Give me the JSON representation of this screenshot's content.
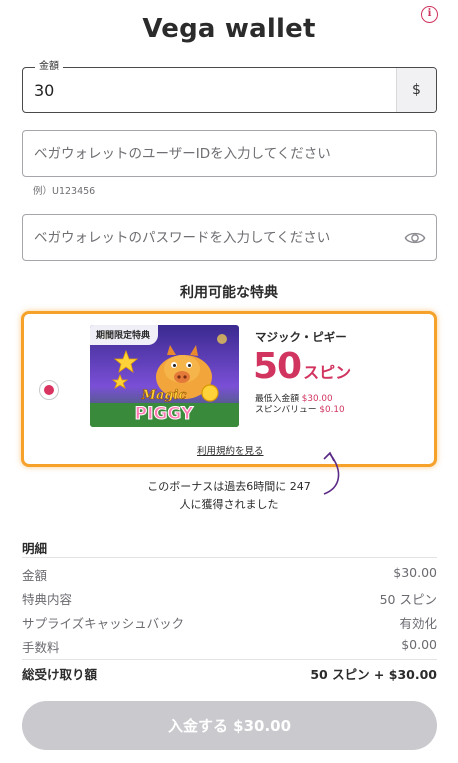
{
  "header": {
    "title": "Vega wallet",
    "info_icon": "i"
  },
  "amount": {
    "label": "金額",
    "value": "30",
    "currency": "$"
  },
  "user_id": {
    "placeholder": "ベガウォレットのユーザーIDを入力してください",
    "helper": "例）U123456"
  },
  "password": {
    "placeholder": "ベガウォレットのパスワードを入力してください"
  },
  "bonus_section": {
    "title": "利用可能な特典",
    "offer": {
      "badge": "期間限定特典",
      "game_logo_line1": "Magic",
      "game_logo_line2": "PIGGY",
      "name": "マジック・ピギー",
      "amount_number": "50",
      "amount_unit": "スピン",
      "min_deposit_label": "最低入金額",
      "min_deposit_value": "$30.00",
      "spin_value_label": "スピンバリュー",
      "spin_value_value": "$0.10",
      "terms_link": "利用規約を見る",
      "selected": true
    },
    "social_proof_line1": "このボーナスは過去6時間に 247",
    "social_proof_line2": "人に獲得されました"
  },
  "breakdown": {
    "title": "明細",
    "rows": [
      {
        "label": "金額",
        "value": "$30.00"
      },
      {
        "label": "特典内容",
        "value": "50 スピン"
      },
      {
        "label": "サプライズキャッシュバック",
        "value": "有効化"
      },
      {
        "label": "手数料",
        "value": "$0.00"
      }
    ],
    "total": {
      "label": "総受け取り額",
      "value": "50 スピン + $30.00"
    }
  },
  "deposit_button": {
    "label": "入金する $30.00",
    "enabled": false
  },
  "colors": {
    "accent": "#d0345f",
    "highlight_border": "#f5a12a",
    "button_disabled": "#c9c9ce"
  }
}
